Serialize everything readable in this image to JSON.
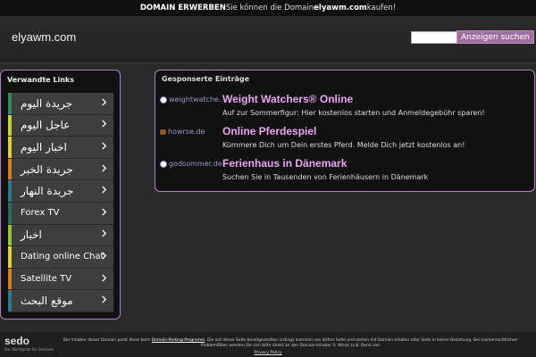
{
  "topbar": {
    "lead": "DOMAIN ERWERBEN",
    "text_before": " Sie können die Domain ",
    "domain": "elyawm.com",
    "text_after": " kaufen!"
  },
  "header": {
    "logo": "elyawm.com",
    "search_button": "Anzeigen suchen",
    "search_value": ""
  },
  "left_panel": {
    "title": "Verwandte Links",
    "items": [
      {
        "label": "جريدة اليوم",
        "color": "#2a8a6a",
        "arabic": true
      },
      {
        "label": "عاجل اليوم",
        "color": "#c8d23a",
        "arabic": true
      },
      {
        "label": "اخبار اليوم",
        "color": "#e2d23a",
        "arabic": true
      },
      {
        "label": "جريدة الخبر",
        "color": "#e0781e",
        "arabic": true
      },
      {
        "label": "جريدة النهار",
        "color": "#2a7a8a",
        "arabic": true
      },
      {
        "label": "Forex TV",
        "color": "#2a6a5a",
        "arabic": false
      },
      {
        "label": "اخبار",
        "color": "#9ac23a",
        "arabic": true
      },
      {
        "label": "Dating online Chat",
        "color": "#e2d23a",
        "arabic": false
      },
      {
        "label": "Satellite TV",
        "color": "#e0781e",
        "arabic": false
      },
      {
        "label": "موقع البحث",
        "color": "#2a7a8a",
        "arabic": true
      }
    ]
  },
  "right_panel": {
    "title": "Gesponserte Einträge",
    "entries": [
      {
        "domain": "weightwatche...",
        "headline": "Weight Watchers® Online",
        "desc": "Auf zur Sommerfigur: Hier kostenlos starten und Anmeldegebühr sparen!",
        "icon": "dot"
      },
      {
        "domain": "howrse.de",
        "headline": "Online Pferdespiel",
        "desc": "Kümmere Dich um Dein erstes Pferd. Melde Dich jetzt kostenlos an!",
        "icon": "favicon"
      },
      {
        "domain": "godsommer.de",
        "headline": "Ferienhaus in Dänemark",
        "desc": "Suchen Sie in Tausenden von Ferienhäusern in Dänemark",
        "icon": "dot"
      }
    ]
  },
  "footer": {
    "sedo": "sedo",
    "sedo_sub": "Der Marktplatz für Domains",
    "line1_a": "Der Inhaber dieser Domain parkt diese beim ",
    "line1_link": "Domain-Parking-Programm",
    "line1_b": ". Die auf dieser Seite bereitgestellten Listings kommen von dritter Seite und stehen mit Domain-Inhaber oder Sedo in keiner Beziehung. Bei markenrechtlichen",
    "line2": "Problemfällen wenden Sie sich bitte direkt an den Domain-Inhaber lt. Whois (z.B. Denic.de)",
    "privacy": "Privacy Policy"
  }
}
